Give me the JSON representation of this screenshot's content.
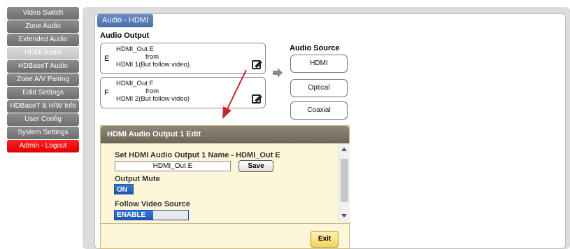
{
  "sidebar": {
    "items": [
      {
        "label": "Video Switch"
      },
      {
        "label": "Zone Audio"
      },
      {
        "label": "Extended Audio"
      },
      {
        "label": "HDMI Audio"
      },
      {
        "label": "HDBaseT Audio"
      },
      {
        "label": "Zone A/V Pairing"
      },
      {
        "label": "Edid Settings"
      },
      {
        "label": "HDBaseT & H/W Info"
      },
      {
        "label": "User Config"
      },
      {
        "label": "System Settings"
      },
      {
        "label": "Admin - Logout"
      }
    ]
  },
  "main": {
    "title": "Audio - HDMI",
    "audio_output_heading": "Audio Output",
    "audio_source_heading": "Audio Source",
    "outputs": [
      {
        "letter": "E",
        "name": "HDMI_Out E",
        "from": "from",
        "source": "HDMI 1(But follow video)"
      },
      {
        "letter": "F",
        "name": "HDMI_Out F",
        "from": "from",
        "source": "HDMI 2(But follow video)"
      }
    ],
    "sources": [
      "HDMI",
      "Optical",
      "Coaxial"
    ]
  },
  "dialog": {
    "title": "HDMI Audio Output 1 Edit",
    "name_label": "Set HDMI Audio Output 1 Name - HDMI_Out E",
    "name_value": "HDMI_Out E",
    "save_label": "Save",
    "mute_label": "Output Mute",
    "mute_toggle": "ON",
    "follow_label": "Follow Video Source",
    "follow_toggle": "ENABLE",
    "exit_label": "Exit"
  },
  "colors": {
    "sidebar_bg": "#7d7d7d",
    "sidebar_active": "#cfcfcf",
    "logout": "#ff0000",
    "title_tab": "#5a7fb6",
    "dialog_bg": "#fdf6d9",
    "toggle_on": "#2f66c8",
    "annotation_arrow": "#c0282a"
  }
}
